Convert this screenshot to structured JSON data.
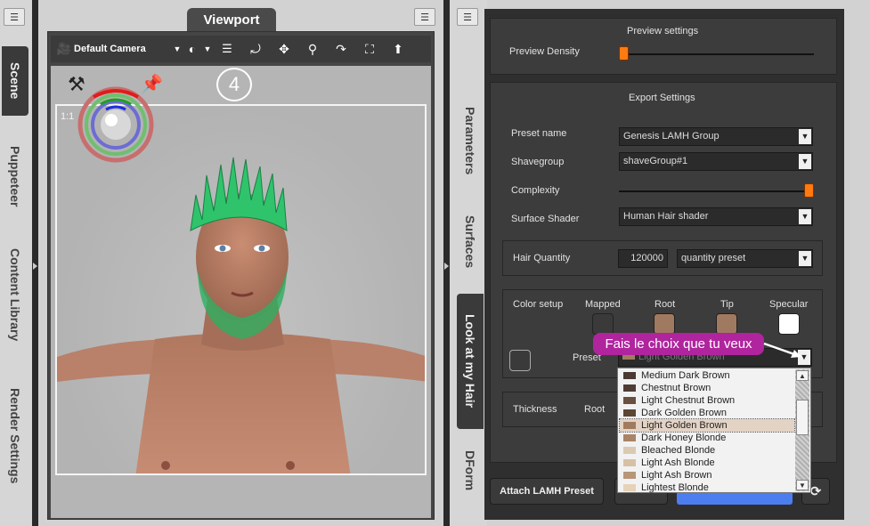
{
  "left_tabs": {
    "scene": "Scene",
    "puppeteer": "Puppeteer",
    "content_library": "Content Library",
    "render_settings": "Render Settings"
  },
  "viewport": {
    "tab_label": "Viewport",
    "camera": "Default Camera",
    "step_badge": "4",
    "ratio_label": "1:1"
  },
  "right_tabs": {
    "parameters": "Parameters",
    "surfaces": "Surfaces",
    "look_at_my_hair": "Look at my Hair",
    "dform": "DForm"
  },
  "preview": {
    "title": "Preview settings",
    "density_label": "Preview Density",
    "density_level": 0.0
  },
  "export": {
    "title": "Export Settings",
    "preset_name_label": "Preset name",
    "preset_name_value": "Genesis LAMH Group",
    "shavegroup_label": "Shavegroup",
    "shavegroup_value": "shaveGroup#1",
    "complexity_label": "Complexity",
    "complexity_level": 1.0,
    "surface_shader_label": "Surface Shader",
    "surface_shader_value": "Human Hair shader"
  },
  "hair_quantity": {
    "label": "Hair Quantity",
    "value": "120000",
    "preset": "quantity preset"
  },
  "color_setup": {
    "label": "Color setup",
    "mapped": "Mapped",
    "root": "Root",
    "tip": "Tip",
    "specular": "Specular",
    "preset_label": "Preset",
    "preset_value": "Light Golden Brown",
    "colors": {
      "mapped": "#3a3a3a",
      "root": "#a07a60",
      "tip": "#a07a60",
      "specular": "#ffffff"
    }
  },
  "thickness": {
    "label": "Thickness",
    "root": "Root"
  },
  "preset_list": [
    {
      "name": "Medium Dark Brown",
      "color": "#4a3a32"
    },
    {
      "name": "Chestnut Brown",
      "color": "#4f3d33"
    },
    {
      "name": "Light Chestnut Brown",
      "color": "#6a5042"
    },
    {
      "name": "Dark Golden Brown",
      "color": "#5c4634"
    },
    {
      "name": "Light Golden Brown",
      "color": "#a07c5e"
    },
    {
      "name": "Dark Honey Blonde",
      "color": "#a98466"
    },
    {
      "name": "Bleached Blonde",
      "color": "#dcc9b2"
    },
    {
      "name": "Light Ash Blonde",
      "color": "#d8c0a6"
    },
    {
      "name": "Light Ash Brown",
      "color": "#b8967a"
    },
    {
      "name": "Lightest Blonde",
      "color": "#e6d2b8"
    }
  ],
  "callout": "Fais le choix que tu veux",
  "bottom": {
    "attach_button": "Attach LAMH Preset"
  }
}
